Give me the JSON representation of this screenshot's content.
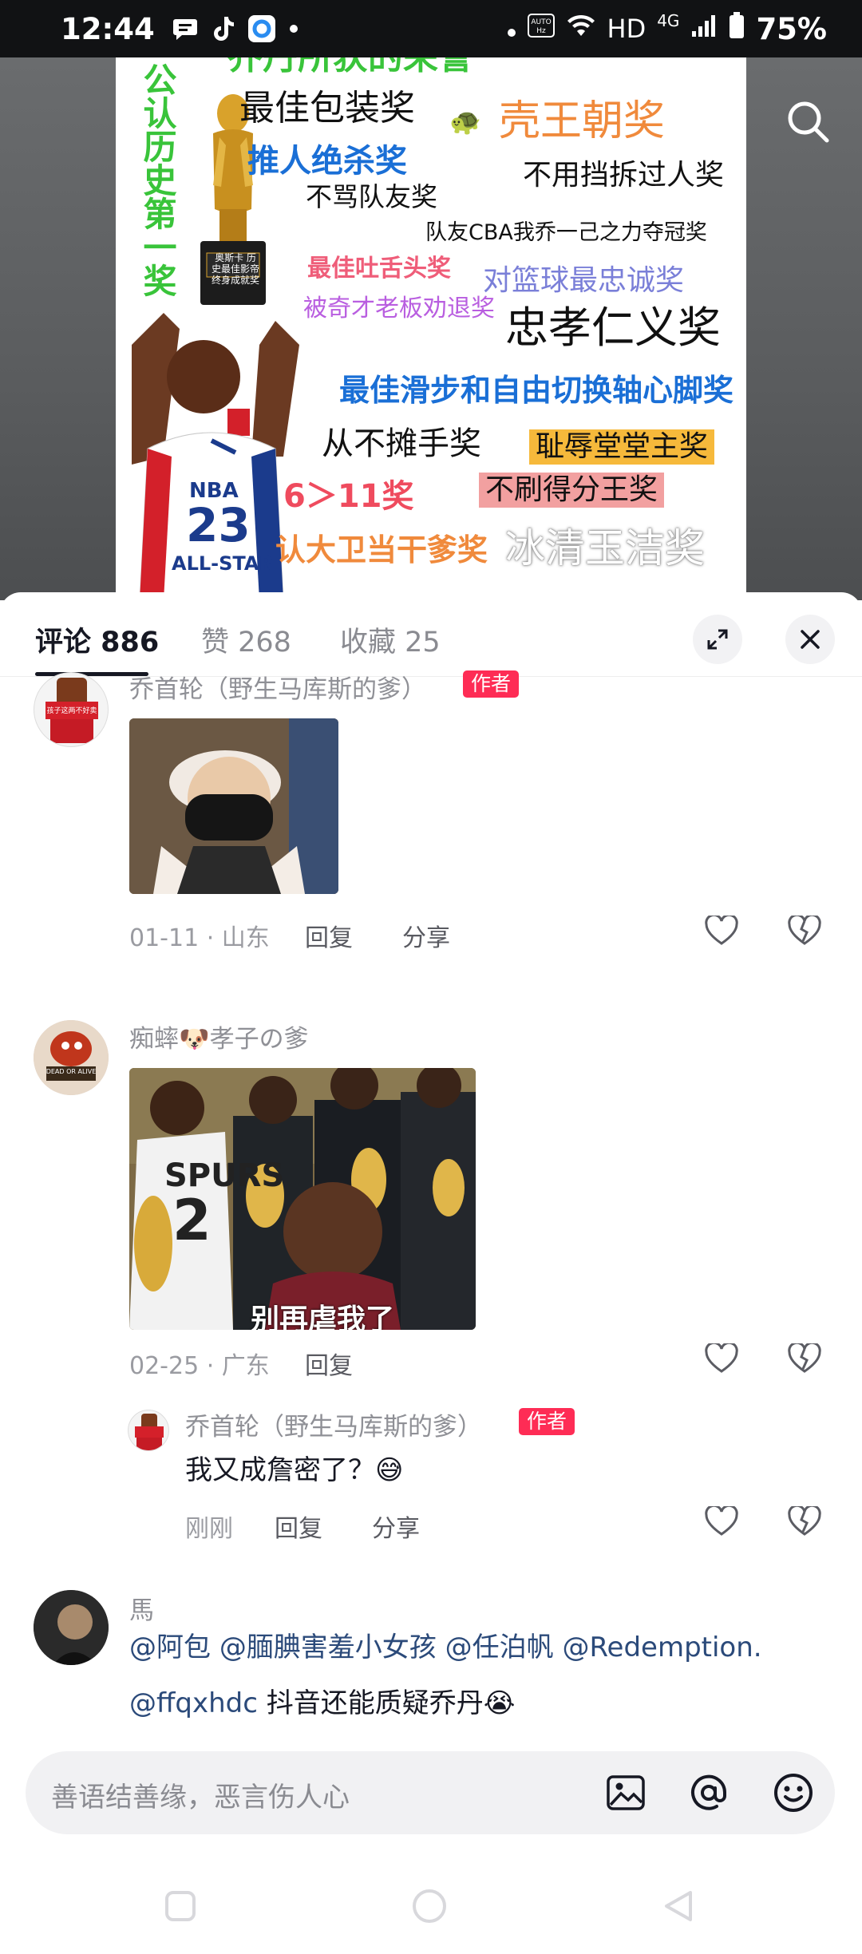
{
  "status_bar": {
    "time": "12:44",
    "hd": "HD",
    "network": "4G",
    "battery": "75%"
  },
  "poster": {
    "header_text": "乔丹所获的荣誉",
    "side_text": "公认历史第一奖",
    "trophy_plate": "奥斯卡 历史最佳影帝 终身成就奖",
    "jersey_team": "NBA",
    "jersey_number": "23",
    "jersey_text": "ALL-STAR",
    "awards": [
      "最佳包装奖",
      "壳王朝奖",
      "推人绝杀奖",
      "不用挡拆过人奖",
      "不骂队友奖",
      "队友CBA我乔一己之力夺冠奖",
      "最佳吐舌头奖",
      "对篮球最忠诚奖",
      "被奇才老板劝退奖",
      "忠孝仁义奖",
      "最佳滑步和自由切换轴心脚奖",
      "从不摊手奖",
      "耻辱堂堂主奖",
      "6＞11奖",
      "不刷得分王奖",
      "认大卫当干爹奖",
      "冰清玉洁奖"
    ]
  },
  "tabs": [
    {
      "label": "评论 886"
    },
    {
      "label": "赞 268"
    },
    {
      "label": "收藏 25"
    }
  ],
  "comments": [
    {
      "username": "乔首轮（野生马库斯的爹）",
      "author_tag": "作者",
      "avatar_text": "孩子这两不好卖",
      "date_location": "01-11 · 山东",
      "reply": "回复",
      "share": "分享"
    },
    {
      "username": "痴蟀🐶孝子の爹",
      "avatar_text": "DEAD OR ALIVE",
      "image_caption": "别再虐我了",
      "jersey_label": "SPURS",
      "jersey_number": "2",
      "date_location": "02-25 · 广东",
      "reply": "回复",
      "replies": [
        {
          "username": "乔首轮（野生马库斯的爹）",
          "author_tag": "作者",
          "text": "我又成詹密了？😅",
          "time": "刚刚",
          "reply": "回复",
          "share": "分享"
        }
      ]
    },
    {
      "username": "馬",
      "mentions_line1": [
        "@阿包",
        "@腼腆害羞小女孩",
        "@任泊帆",
        "@Redemption."
      ],
      "line2_mention": "@ffqxhdc",
      "line2_text": " 抖音还能质疑乔丹😭"
    }
  ],
  "input": {
    "placeholder": "善语结善缘，恶言伤人心"
  },
  "colors": {
    "author_tag": "#fe2c55",
    "mention": "#2b4a7a",
    "text_primary": "#161823",
    "text_secondary": "#8f9096"
  }
}
